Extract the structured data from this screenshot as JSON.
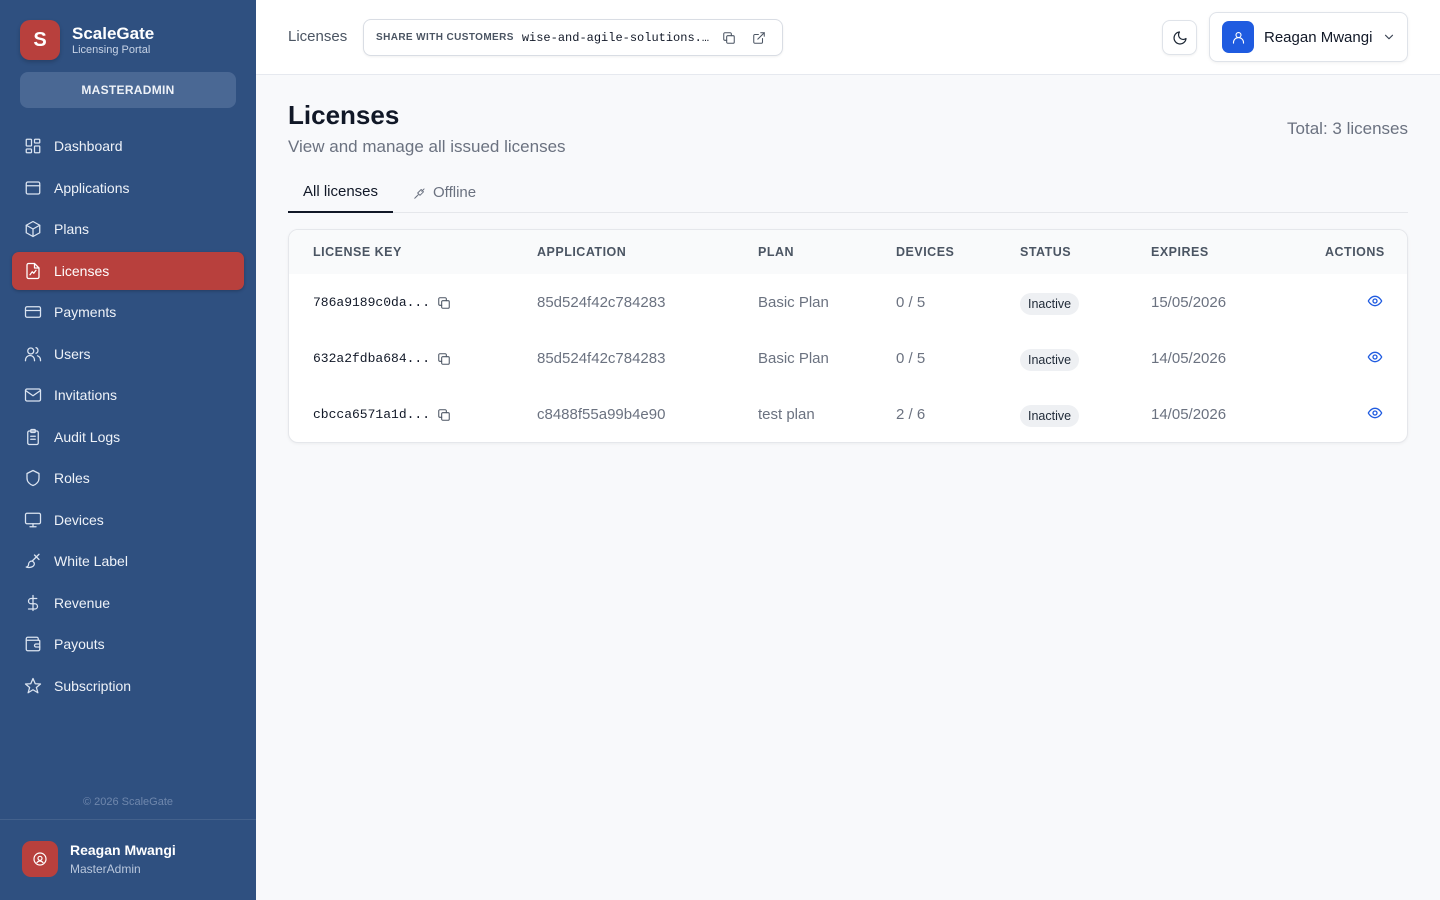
{
  "brand": {
    "initial": "S",
    "name": "ScaleGate",
    "subtitle": "Licensing Portal"
  },
  "role_badge": "MASTERADMIN",
  "sidebar": {
    "items": [
      {
        "label": "Dashboard",
        "icon": "dashboard-icon"
      },
      {
        "label": "Applications",
        "icon": "applications-icon"
      },
      {
        "label": "Plans",
        "icon": "package-icon"
      },
      {
        "label": "Licenses",
        "icon": "license-file-icon",
        "active": true
      },
      {
        "label": "Payments",
        "icon": "credit-card-icon"
      },
      {
        "label": "Users",
        "icon": "users-icon"
      },
      {
        "label": "Invitations",
        "icon": "mail-icon"
      },
      {
        "label": "Audit Logs",
        "icon": "clipboard-icon"
      },
      {
        "label": "Roles",
        "icon": "shield-icon"
      },
      {
        "label": "Devices",
        "icon": "monitor-icon"
      },
      {
        "label": "White Label",
        "icon": "brush-icon"
      },
      {
        "label": "Revenue",
        "icon": "dollar-icon"
      },
      {
        "label": "Payouts",
        "icon": "wallet-icon"
      },
      {
        "label": "Subscription",
        "icon": "star-icon"
      }
    ],
    "copyright": "© 2026 ScaleGate",
    "user": {
      "name": "Reagan Mwangi",
      "role": "MasterAdmin"
    }
  },
  "header": {
    "breadcrumb": "Licenses",
    "share": {
      "label": "SHARE WITH CUSTOMERS",
      "url": "wise-and-agile-solutions.sc…"
    },
    "user_name": "Reagan Mwangi"
  },
  "main": {
    "title": "Licenses",
    "subtitle": "View and manage all issued licenses",
    "total": "Total: 3 licenses",
    "tabs": [
      {
        "label": "All licenses"
      },
      {
        "label": "Offline"
      }
    ],
    "table": {
      "columns": [
        "LICENSE KEY",
        "APPLICATION",
        "PLAN",
        "DEVICES",
        "STATUS",
        "EXPIRES",
        "ACTIONS"
      ],
      "rows": [
        {
          "key": "786a9189c0da...",
          "application": "85d524f42c784283",
          "plan": "Basic Plan",
          "devices": "0 / 5",
          "status": "Inactive",
          "expires": "15/05/2026"
        },
        {
          "key": "632a2fdba684...",
          "application": "85d524f42c784283",
          "plan": "Basic Plan",
          "devices": "0 / 5",
          "status": "Inactive",
          "expires": "14/05/2026"
        },
        {
          "key": "cbcca6571a1d...",
          "application": "c8488f55a99b4e90",
          "plan": "test plan",
          "devices": "2 / 6",
          "status": "Inactive",
          "expires": "14/05/2026"
        }
      ]
    }
  },
  "colors": {
    "sidebar_bg": "#2f5080",
    "accent_red": "#b8403d",
    "accent_blue": "#1f5be0"
  }
}
